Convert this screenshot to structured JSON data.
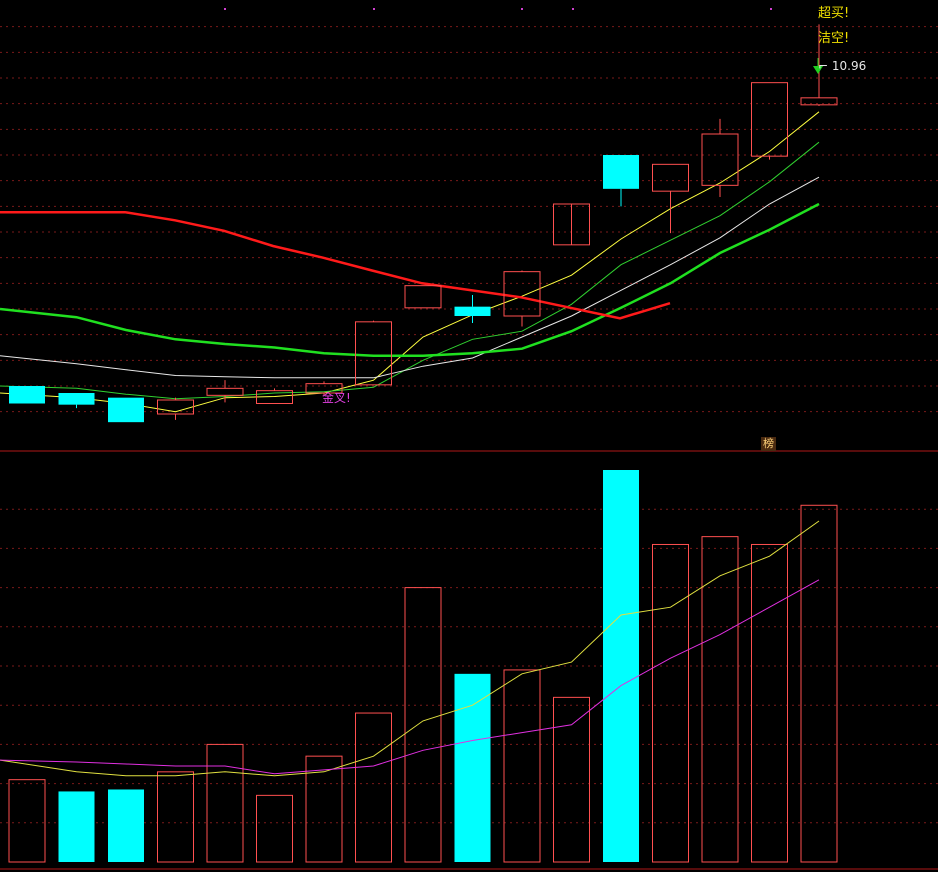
{
  "labels": {
    "top_signal_1": "超买!",
    "top_signal_2": "洁空!",
    "high_price": "10.96",
    "mid_marker": "金叉!",
    "lower_badge": "榜"
  },
  "colors": {
    "up": "#ff5050",
    "down": "#00ffff",
    "ma_red": "#ff1a1a",
    "ma_green_thick": "#20e020",
    "ma_white": "#e8e8e8",
    "ma_yellow": "#ffff40",
    "ma_green_thin": "#30d030",
    "vol_ma_yellow": "#e0e040",
    "vol_ma_magenta": "#e030e0",
    "grid": "#7a1a1a",
    "divider": "#b01818"
  },
  "chart_data": [
    {
      "type": "candlestick",
      "ylim": [
        7.5,
        11.1
      ],
      "candles": [
        {
          "o": 7.86,
          "h": 7.86,
          "c": 7.71,
          "l": 7.71
        },
        {
          "o": 7.8,
          "h": 7.8,
          "c": 7.7,
          "l": 7.67
        },
        {
          "o": 7.76,
          "h": 7.76,
          "c": 7.55,
          "l": 7.55
        },
        {
          "o": 7.62,
          "h": 7.76,
          "c": 7.74,
          "l": 7.57
        },
        {
          "o": 7.78,
          "h": 7.91,
          "c": 7.84,
          "l": 7.72
        },
        {
          "o": 7.71,
          "h": 7.84,
          "c": 7.82,
          "l": 7.71
        },
        {
          "o": 7.8,
          "h": 7.9,
          "c": 7.88,
          "l": 7.78
        },
        {
          "o": 7.87,
          "h": 8.42,
          "c": 8.41,
          "l": 7.87
        },
        {
          "o": 8.53,
          "h": 8.72,
          "c": 8.72,
          "l": 8.53
        },
        {
          "o": 8.54,
          "h": 8.64,
          "c": 8.46,
          "l": 8.4
        },
        {
          "o": 8.46,
          "h": 8.85,
          "c": 8.84,
          "l": 8.37
        },
        {
          "o": 9.07,
          "h": 9.07,
          "c": 9.42,
          "l": 9.07
        },
        {
          "o": 9.84,
          "h": 9.84,
          "c": 9.55,
          "l": 9.4
        },
        {
          "o": 9.53,
          "h": 9.76,
          "c": 9.76,
          "l": 9.17
        },
        {
          "o": 9.58,
          "h": 10.15,
          "c": 10.02,
          "l": 9.48
        },
        {
          "o": 9.83,
          "h": 10.46,
          "c": 10.46,
          "l": 9.8
        },
        {
          "o": 10.27,
          "h": 10.96,
          "c": 10.33,
          "l": 10.26
        }
      ],
      "moving_averages": [
        {
          "color_key": "ma_yellow",
          "values": [
            7.8,
            7.76,
            7.71,
            7.64,
            7.76,
            7.77,
            7.8,
            7.91,
            8.28,
            8.47,
            8.63,
            8.81,
            9.12,
            9.38,
            9.6,
            9.87,
            10.21
          ]
        },
        {
          "color_key": "ma_green_thin",
          "values": [
            7.86,
            7.84,
            7.79,
            7.75,
            7.77,
            7.8,
            7.81,
            7.85,
            8.08,
            8.26,
            8.33,
            8.56,
            8.9,
            9.11,
            9.32,
            9.61,
            9.95
          ]
        },
        {
          "color_key": "ma_white",
          "values": [
            8.12,
            8.05,
            8.0,
            7.95,
            7.94,
            7.93,
            7.93,
            7.93,
            8.03,
            8.1,
            8.28,
            8.46,
            8.68,
            8.9,
            9.13,
            9.42,
            9.65
          ]
        },
        {
          "color_key": "ma_green_thick",
          "values": [
            8.52,
            8.45,
            8.34,
            8.26,
            8.22,
            8.19,
            8.14,
            8.12,
            8.12,
            8.14,
            8.18,
            8.33,
            8.53,
            8.74,
            9.0,
            9.2,
            9.42
          ]
        },
        {
          "color_key": "ma_red",
          "values": [
            9.35,
            9.35,
            9.35,
            9.35,
            9.28,
            9.19,
            9.06,
            8.96,
            8.85,
            8.74,
            8.62,
            8.44,
            8.57
          ]
        }
      ],
      "yticks": [
        7.64,
        7.86,
        8.08,
        8.3,
        8.52,
        8.74,
        8.96,
        9.18,
        9.4,
        9.62,
        9.84,
        10.06,
        10.28,
        10.5,
        10.72,
        10.94
      ]
    },
    {
      "type": "bar",
      "title": "volume",
      "ylim": [
        0,
        100
      ],
      "values": [
        21,
        18,
        18.5,
        23,
        30,
        17,
        27,
        38,
        70,
        48,
        49,
        42,
        100,
        81,
        83,
        81,
        91
      ],
      "directions": [
        "up",
        "down",
        "down",
        "up",
        "up",
        "up",
        "up",
        "up",
        "up",
        "down",
        "up",
        "up",
        "down",
        "up",
        "up",
        "up",
        "up"
      ],
      "ma_short": [
        26,
        23,
        22,
        22,
        23,
        22,
        23,
        27,
        36,
        40,
        48,
        51,
        63,
        65,
        73,
        78,
        87
      ],
      "ma_long": [
        26,
        25.5,
        25,
        24.5,
        24.5,
        22.5,
        23.5,
        24.5,
        28.5,
        31,
        33,
        35,
        45,
        52,
        58,
        65,
        72
      ]
    }
  ]
}
